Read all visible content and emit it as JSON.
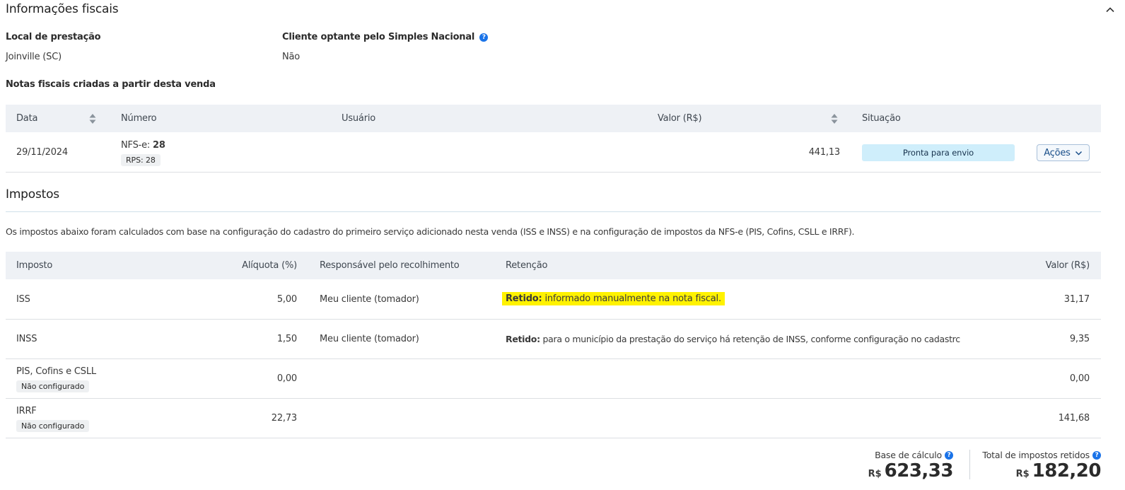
{
  "section": {
    "title": "Informações fiscais"
  },
  "fiscal": {
    "local_label": "Local de prestação",
    "local_value": "Joinville (SC)",
    "simples_label": "Cliente optante pelo Simples Nacional",
    "simples_value": "Não",
    "notas_title": "Notas fiscais criadas a partir desta venda"
  },
  "notas_table": {
    "headers": {
      "data": "Data",
      "numero": "Número",
      "usuario": "Usuário",
      "valor": "Valor (R$)",
      "situacao": "Situação"
    },
    "rows": [
      {
        "data": "29/11/2024",
        "nfse_prefix": "NFS-e: ",
        "nfse_number": "28",
        "rps": "RPS: 28",
        "usuario": "",
        "valor": "441,13",
        "situacao": "Pronta para envio",
        "acoes": "Ações"
      }
    ]
  },
  "impostos": {
    "title": "Impostos",
    "description": "Os impostos abaixo foram calculados com base na configuração do cadastro do primeiro serviço adicionado nesta venda (ISS e INSS) e na configuração de impostos da NFS-e (PIS, Cofins, CSLL e IRRF).",
    "headers": {
      "imposto": "Imposto",
      "aliquota": "Alíquota (%)",
      "responsavel": "Responsável pelo recolhimento",
      "retencao": "Retenção",
      "valor": "Valor (R$)"
    },
    "rows": [
      {
        "imposto": "ISS",
        "tag": "",
        "aliquota": "5,00",
        "responsavel": "Meu cliente (tomador)",
        "retencao_bold": "Retido:",
        "retencao_text": " informado manualmente na nota fiscal.",
        "valor": "31,17"
      },
      {
        "imposto": "INSS",
        "tag": "",
        "aliquota": "1,50",
        "responsavel": "Meu cliente (tomador)",
        "retencao_bold": "Retido:",
        "retencao_text": " para o município da prestação do serviço há retenção de INSS, conforme configuração no cadastrc",
        "valor": "9,35"
      },
      {
        "imposto": "PIS, Cofins e CSLL",
        "tag": "Não configurado",
        "aliquota": "0,00",
        "responsavel": "",
        "retencao_bold": "",
        "retencao_text": "",
        "valor": "0,00"
      },
      {
        "imposto": "IRRF",
        "tag": "Não configurado",
        "aliquota": "22,73",
        "responsavel": "",
        "retencao_bold": "",
        "retencao_text": "",
        "valor": "141,68"
      }
    ]
  },
  "totals": {
    "base_label": "Base de cálculo",
    "base_currency": "R$",
    "base_value": "623,33",
    "retidos_label": "Total de impostos retidos",
    "retidos_currency": "R$",
    "retidos_value": "182,20"
  },
  "colors": {
    "accent": "#1a73e8",
    "highlight": "#fff200",
    "status_bg": "#cfeefb",
    "header_bg": "#eef1f5"
  }
}
